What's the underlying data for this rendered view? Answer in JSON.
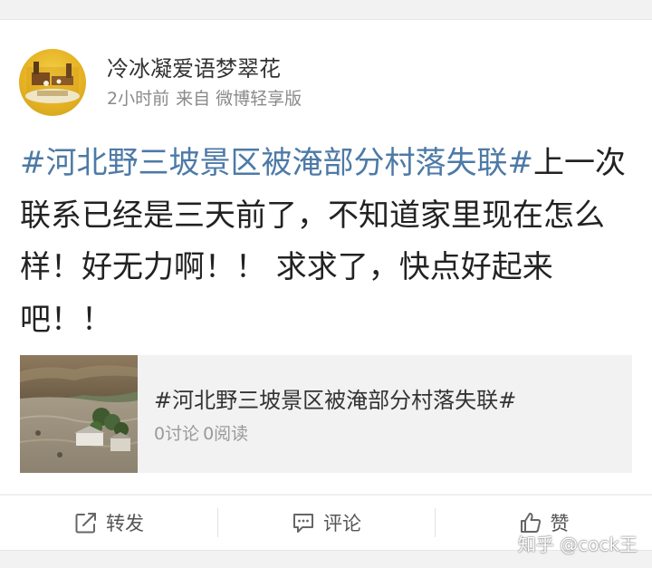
{
  "post": {
    "username": "冷冰凝爱语梦翠花",
    "time": "2小时前",
    "source": "来自 微博轻享版",
    "hashtag": "#河北野三坡景区被淹部分村落失联#",
    "body": "上一次联系已经是三天前了，不知道家里现在怎么样！好无力啊！！ 求求了，快点好起来吧！！"
  },
  "topic_card": {
    "title": "#河北野三坡景区被淹部分村落失联#",
    "discussions": "0讨论",
    "reads": "0阅读"
  },
  "actions": {
    "repost": "转发",
    "comment": "评论",
    "like": "赞"
  },
  "watermark": "知乎 @cock王",
  "colors": {
    "hashtag": "#4d7aa6",
    "text": "#222222",
    "meta": "#8a8a8a",
    "background": "#f2f2f2"
  }
}
